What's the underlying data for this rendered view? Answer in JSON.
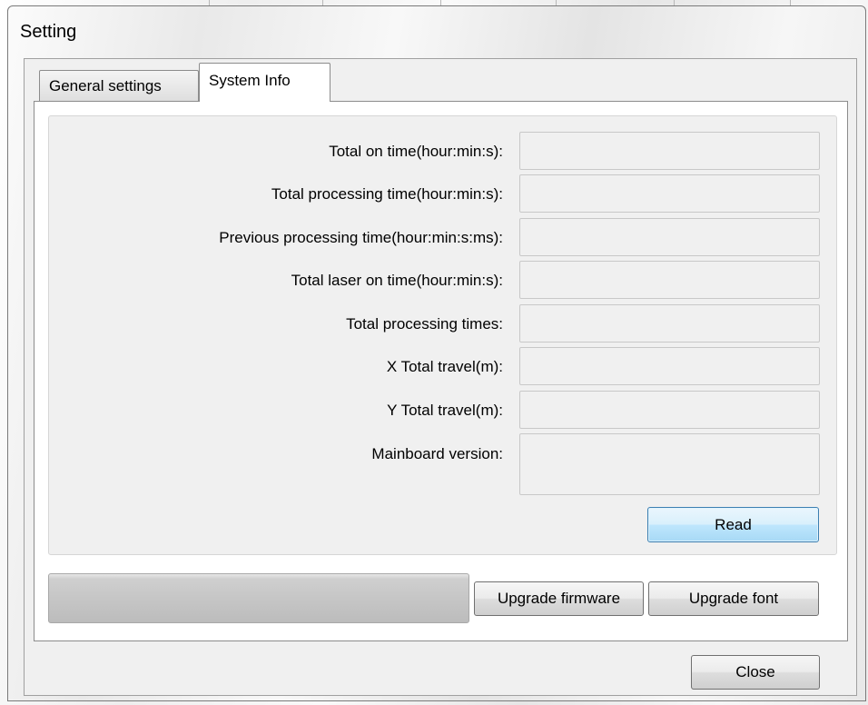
{
  "window": {
    "title": "Setting"
  },
  "tabs": [
    {
      "label": "General settings",
      "active": false
    },
    {
      "label": "System Info",
      "active": true
    }
  ],
  "system_info": {
    "fields": [
      {
        "label": "Total on time(hour:min:s):",
        "value": ""
      },
      {
        "label": "Total processing time(hour:min:s):",
        "value": ""
      },
      {
        "label": "Previous processing time(hour:min:s:ms):",
        "value": ""
      },
      {
        "label": "Total laser on time(hour:min:s):",
        "value": ""
      },
      {
        "label": "Total processing times:",
        "value": ""
      },
      {
        "label": "X Total travel(m):",
        "value": ""
      },
      {
        "label": "Y Total travel(m):",
        "value": ""
      },
      {
        "label": "Mainboard version:",
        "value": ""
      }
    ],
    "read_label": "Read"
  },
  "upgrade": {
    "progress_fraction": 0,
    "firmware_label": "Upgrade firmware",
    "font_label": "Upgrade font"
  },
  "footer": {
    "close_label": "Close"
  }
}
